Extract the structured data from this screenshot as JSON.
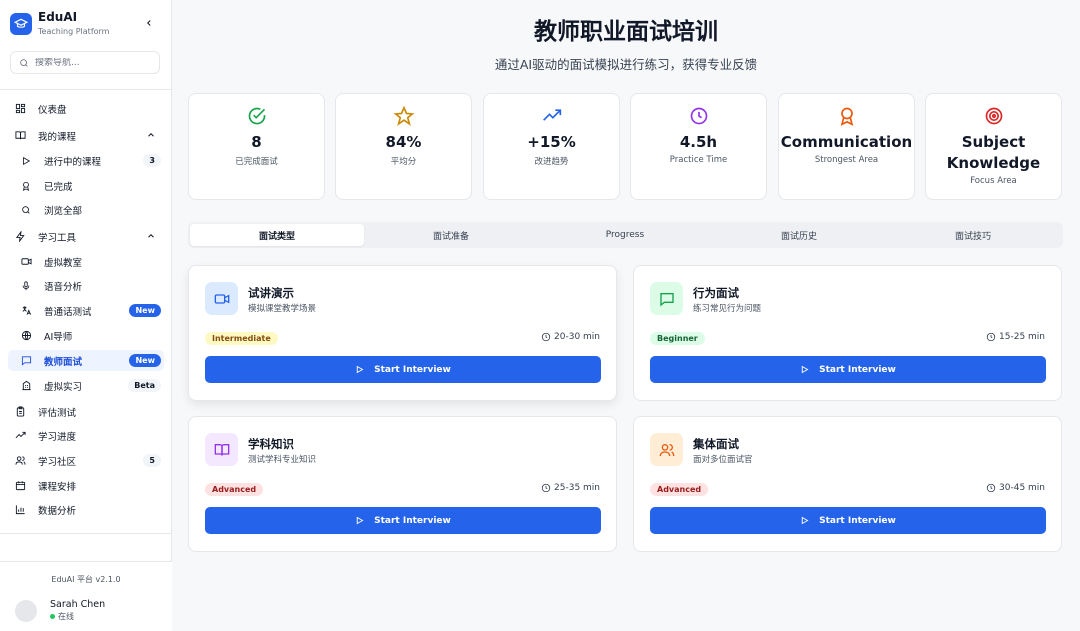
{
  "app": {
    "name": "EduAI",
    "subtitle": "Teaching Platform",
    "version": "EduAI 平台 v2.1.0"
  },
  "search": {
    "placeholder": "搜索导航..."
  },
  "sidebar": {
    "items": [
      {
        "label": "仪表盘",
        "icon": "dashboard-icon"
      },
      {
        "label": "我的课程",
        "icon": "book-icon"
      },
      {
        "label": "进行中的课程",
        "icon": "play-icon",
        "badge": "3"
      },
      {
        "label": "已完成",
        "icon": "award-icon"
      },
      {
        "label": "浏览全部",
        "icon": "search-icon"
      },
      {
        "label": "学习工具",
        "icon": "zap-icon"
      },
      {
        "label": "虚拟教室",
        "icon": "video-icon"
      },
      {
        "label": "语音分析",
        "icon": "mic-icon"
      },
      {
        "label": "普通话测试",
        "icon": "translate-icon",
        "badge": "New"
      },
      {
        "label": "AI导师",
        "icon": "globe-icon"
      },
      {
        "label": "教师面试",
        "icon": "chat-icon",
        "badge": "New"
      },
      {
        "label": "虚拟实习",
        "icon": "building-icon",
        "badge": "Beta"
      },
      {
        "label": "评估测试",
        "icon": "clipboard-icon"
      },
      {
        "label": "学习进度",
        "icon": "trend-icon"
      },
      {
        "label": "学习社区",
        "icon": "users-icon",
        "badge": "5"
      },
      {
        "label": "课程安排",
        "icon": "calendar-icon"
      },
      {
        "label": "数据分析",
        "icon": "bar-chart-icon"
      }
    ]
  },
  "user": {
    "name": "Sarah Chen",
    "status": "在线"
  },
  "page": {
    "title": "教师职业面试培训",
    "subtitle": "通过AI驱动的面试模拟进行练习，获得专业反馈"
  },
  "stats": [
    {
      "value": "8",
      "label": "已完成面试",
      "icon": "check-circle-icon",
      "color": "#16a34a"
    },
    {
      "value": "84%",
      "label": "平均分",
      "icon": "star-icon",
      "color": "#ca8a04"
    },
    {
      "value": "+15%",
      "label": "改进趋势",
      "icon": "trend-up-icon",
      "color": "#2563eb"
    },
    {
      "value": "4.5h",
      "label": "Practice Time",
      "icon": "clock-icon",
      "color": "#9333ea"
    },
    {
      "value": "Communication",
      "label": "Strongest Area",
      "icon": "award-icon",
      "color": "#ea580c"
    },
    {
      "value": "Subject Knowledge",
      "label": "Focus Area",
      "icon": "target-icon",
      "color": "#dc2626"
    }
  ],
  "tabs": [
    "面试类型",
    "面试准备",
    "Progress",
    "面试历史",
    "面试技巧"
  ],
  "cards": [
    {
      "title": "试讲演示",
      "desc": "模拟课堂教学场景",
      "level": "Intermediate",
      "duration": "20-30 min",
      "button": "Start Interview",
      "icon": "video-icon"
    },
    {
      "title": "行为面试",
      "desc": "练习常见行为问题",
      "level": "Beginner",
      "duration": "15-25 min",
      "button": "Start Interview",
      "icon": "chat-icon"
    },
    {
      "title": "学科知识",
      "desc": "测试学科专业知识",
      "level": "Advanced",
      "duration": "25-35 min",
      "button": "Start Interview",
      "icon": "book-open-icon"
    },
    {
      "title": "集体面试",
      "desc": "面对多位面试官",
      "level": "Advanced",
      "duration": "30-45 min",
      "button": "Start Interview",
      "icon": "users-icon"
    }
  ],
  "colors": {
    "accent": "#2563eb",
    "active_bg": "#eef4ff"
  }
}
